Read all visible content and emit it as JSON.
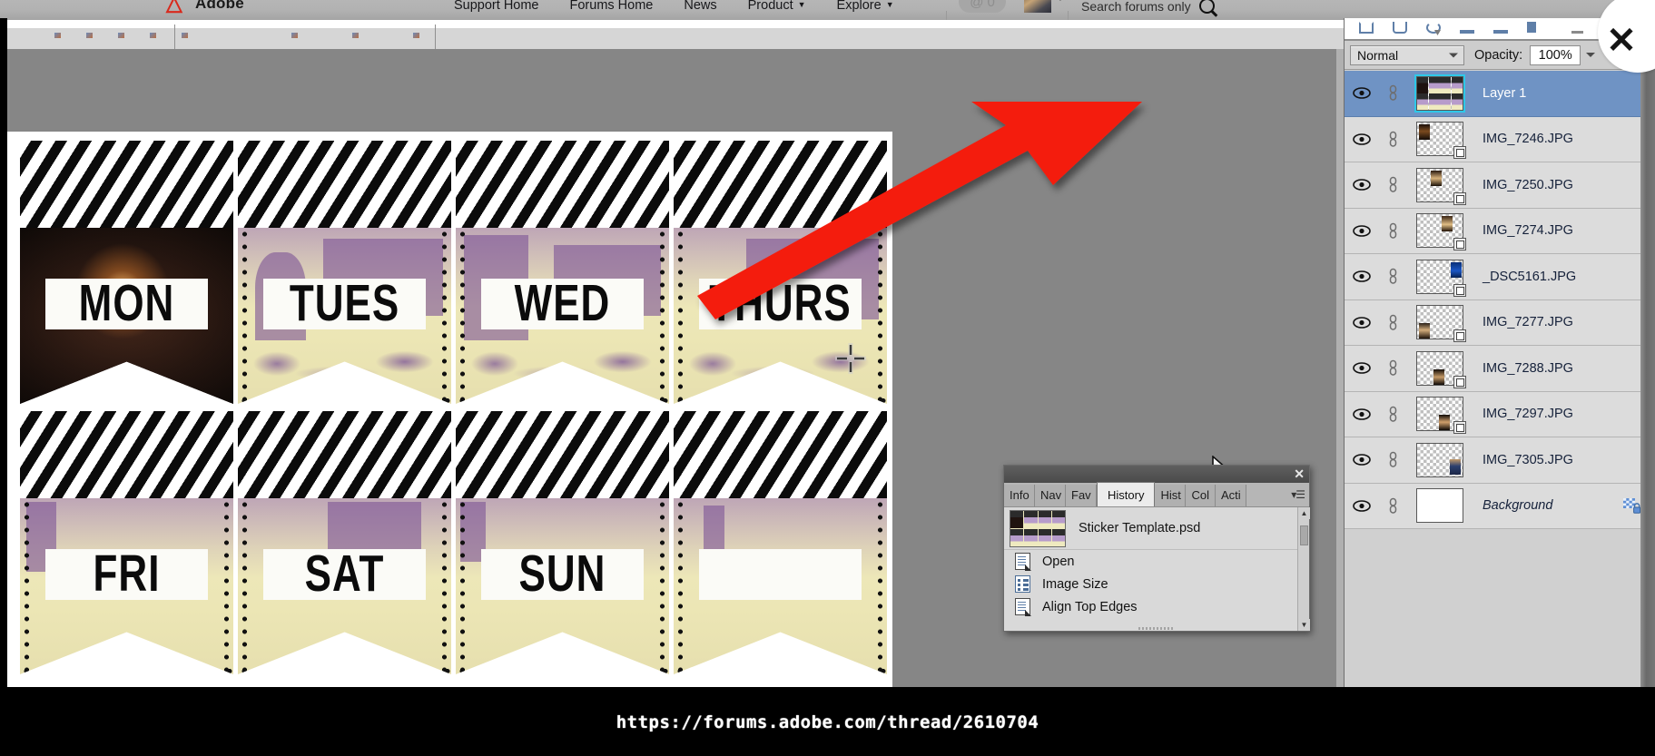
{
  "forum_header": {
    "brand": "Adobe",
    "logo_glyph": "adobe-logo-icon",
    "nav": [
      {
        "label": "Support Home",
        "has_caret": false
      },
      {
        "label": "Forums Home",
        "has_caret": false
      },
      {
        "label": "News",
        "has_caret": false
      },
      {
        "label": "Product",
        "has_caret": true
      },
      {
        "label": "Explore",
        "has_caret": true
      }
    ],
    "mention_badge": {
      "icon": "at-icon",
      "count": "0"
    },
    "search_placeholder": "Search forums only",
    "search_icon": "search-icon"
  },
  "photoshop": {
    "document": {
      "name": "Sticker Template.psd",
      "stickers": [
        {
          "label": "MON",
          "photo": "dark"
        },
        {
          "label": "TUES",
          "photo": "venice"
        },
        {
          "label": "WED",
          "photo": "venice"
        },
        {
          "label": "THURS",
          "photo": "venice"
        },
        {
          "label": "FRI",
          "photo": "dark"
        },
        {
          "label": "SAT",
          "photo": "venice"
        },
        {
          "label": "SUN",
          "photo": "venice"
        },
        {
          "label": "",
          "photo": "venice"
        }
      ]
    },
    "layers_panel": {
      "blend_mode": "Normal",
      "opacity_label": "Opacity:",
      "opacity_value": "100%",
      "selected_layer": "Layer 1",
      "layers": [
        {
          "name": "Layer 1",
          "visible": true,
          "linked": true,
          "selected": true,
          "kind": "sticker-sheet",
          "locked": false,
          "italic": false
        },
        {
          "name": "IMG_7246.JPG",
          "visible": true,
          "linked": true,
          "selected": false,
          "kind": "smart-object",
          "locked": false,
          "italic": false,
          "mini_pos": "tl",
          "mini_tone": "dark"
        },
        {
          "name": "IMG_7250.JPG",
          "visible": true,
          "linked": true,
          "selected": false,
          "kind": "smart-object",
          "locked": false,
          "italic": false,
          "mini_pos": "tc",
          "mini_tone": "dark"
        },
        {
          "name": "IMG_7274.JPG",
          "visible": true,
          "linked": true,
          "selected": false,
          "kind": "smart-object",
          "locked": false,
          "italic": false,
          "mini_pos": "tr",
          "mini_tone": "warm"
        },
        {
          "name": "_DSC5161.JPG",
          "visible": true,
          "linked": true,
          "selected": false,
          "kind": "smart-object",
          "locked": false,
          "italic": false,
          "mini_pos": "tr2",
          "mini_tone": "blue"
        },
        {
          "name": "IMG_7277.JPG",
          "visible": true,
          "linked": true,
          "selected": false,
          "kind": "smart-object",
          "locked": false,
          "italic": false,
          "mini_pos": "bl",
          "mini_tone": "warm"
        },
        {
          "name": "IMG_7288.JPG",
          "visible": true,
          "linked": true,
          "selected": false,
          "kind": "smart-object",
          "locked": false,
          "italic": false,
          "mini_pos": "bc",
          "mini_tone": "dark"
        },
        {
          "name": "IMG_7297.JPG",
          "visible": true,
          "linked": true,
          "selected": false,
          "kind": "smart-object",
          "locked": false,
          "italic": false,
          "mini_pos": "bc2",
          "mini_tone": "dark"
        },
        {
          "name": "IMG_7305.JPG",
          "visible": true,
          "linked": true,
          "selected": false,
          "kind": "smart-object",
          "locked": false,
          "italic": false,
          "mini_pos": "br",
          "mini_tone": "warm"
        },
        {
          "name": "Background",
          "visible": true,
          "linked": true,
          "selected": false,
          "kind": "background",
          "locked": true,
          "italic": true
        }
      ],
      "eye_icon": "eye-icon",
      "link_icon": "link-icon",
      "lock_icon": "lock-icon"
    },
    "history_panel": {
      "tabs": [
        {
          "label": "Info",
          "active": false
        },
        {
          "label": "Nav",
          "active": false
        },
        {
          "label": "Fav",
          "active": false
        },
        {
          "label": "History",
          "active": true
        },
        {
          "label": "Hist",
          "active": false
        },
        {
          "label": "Col",
          "active": false
        },
        {
          "label": "Acti",
          "active": false
        }
      ],
      "snapshot": "Sticker Template.psd",
      "states": [
        {
          "label": "Open",
          "icon": "document-icon"
        },
        {
          "label": "Image Size",
          "icon": "list-icon"
        },
        {
          "label": "Align Top Edges",
          "icon": "document-icon"
        }
      ],
      "close_icon": "close-icon",
      "menu_icon": "panel-menu-icon"
    }
  },
  "annotation": {
    "arrow_color": "#f41c0c",
    "arrow_name": "red-pointer-arrow"
  },
  "overlay": {
    "close_label": "✕"
  },
  "footer": {
    "url": "https://forums.adobe.com/thread/2610704"
  }
}
